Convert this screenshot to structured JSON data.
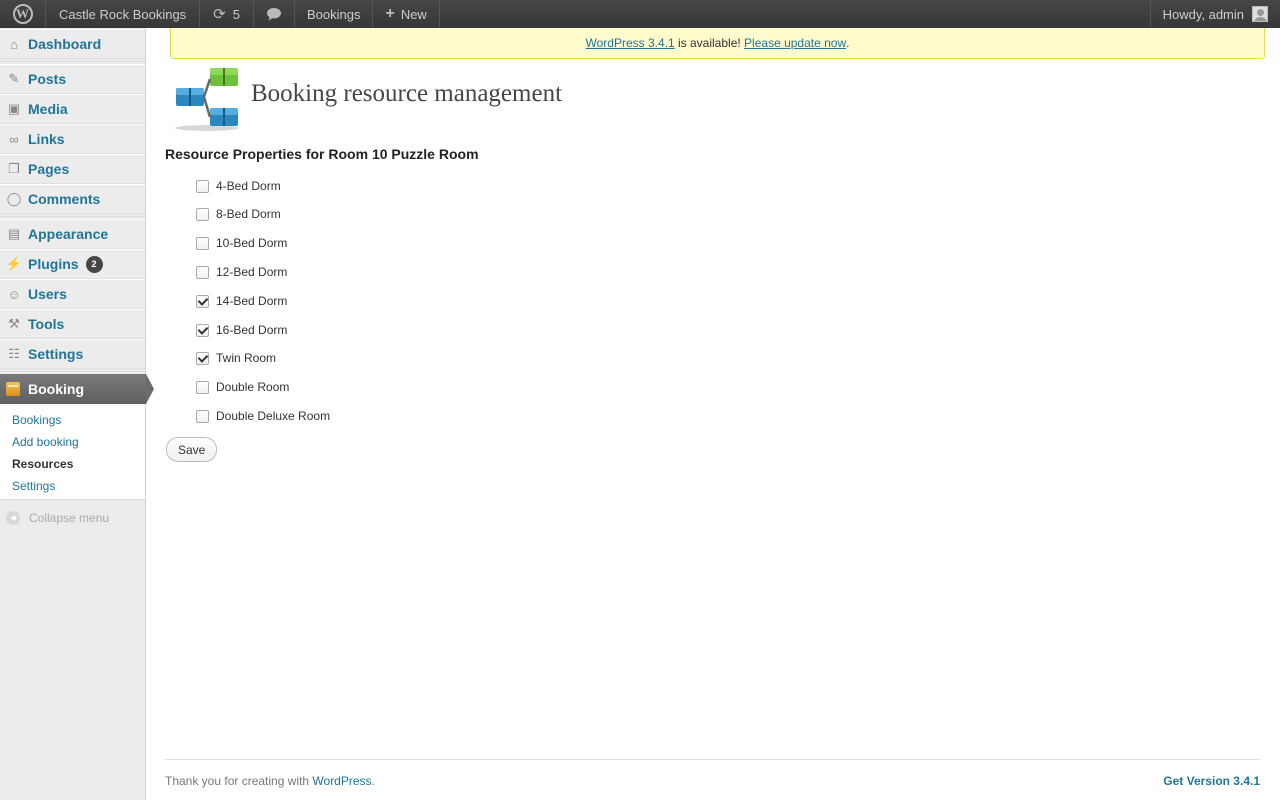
{
  "admin_bar": {
    "site_name": "Castle Rock Bookings",
    "updates_count": "5",
    "bookings_label": "Bookings",
    "new_label": "New",
    "howdy": "Howdy, admin"
  },
  "sidebar": {
    "items": [
      {
        "label": "Dashboard"
      },
      {
        "label": "Posts"
      },
      {
        "label": "Media"
      },
      {
        "label": "Links"
      },
      {
        "label": "Pages"
      },
      {
        "label": "Comments"
      },
      {
        "label": "Appearance"
      },
      {
        "label": "Plugins",
        "badge": "2"
      },
      {
        "label": "Users"
      },
      {
        "label": "Tools"
      },
      {
        "label": "Settings"
      }
    ],
    "current": "Booking",
    "submenu": [
      "Bookings",
      "Add booking",
      "Resources",
      "Settings"
    ],
    "collapse": "Collapse menu"
  },
  "notice": {
    "link1": "WordPress 3.4.1",
    "text": " is available! ",
    "link2": "Please update now",
    "end": "."
  },
  "page": {
    "title": "Booking resource management",
    "section_title": "Resource Properties for Room 10 Puzzle Room",
    "properties": [
      {
        "label": "4-Bed Dorm",
        "checked": false
      },
      {
        "label": "8-Bed Dorm",
        "checked": false
      },
      {
        "label": "10-Bed Dorm",
        "checked": false
      },
      {
        "label": "12-Bed Dorm",
        "checked": false
      },
      {
        "label": "14-Bed Dorm",
        "checked": true
      },
      {
        "label": "16-Bed Dorm",
        "checked": true
      },
      {
        "label": "Twin Room",
        "checked": true
      },
      {
        "label": "Double Room",
        "checked": false
      },
      {
        "label": "Double Deluxe Room",
        "checked": false
      }
    ],
    "save_label": "Save"
  },
  "footer": {
    "thanks": "Thank you for creating with ",
    "wp_link": "WordPress",
    "period": ".",
    "version": "Get Version 3.4.1"
  },
  "colors": {
    "link": "#21759b",
    "admin_bar": "#464646",
    "notice_bg": "#fffbcc"
  }
}
